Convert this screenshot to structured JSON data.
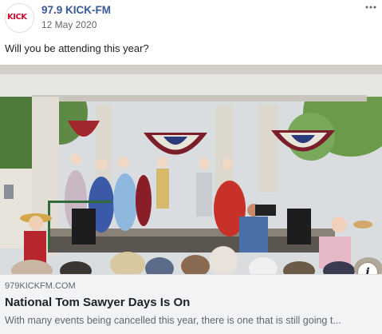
{
  "post": {
    "page_name": "97.9 KICK-FM",
    "avatar_logo": "KICK",
    "date": "12 May 2020",
    "text": "Will you be attending this year?",
    "more_icon": "more-horizontal-icon"
  },
  "link_preview": {
    "image_description": "photo",
    "domain": "979KICKFM.COM",
    "title": "National Tom Sawyer Days Is On",
    "description": "With many events being cancelled this year, there is one that is still going t...",
    "info_label": "i"
  },
  "colors": {
    "page_name": "#385898",
    "meta_background": "#f2f3f5",
    "muted_text": "#606770",
    "logo_red": "#c8102e"
  }
}
